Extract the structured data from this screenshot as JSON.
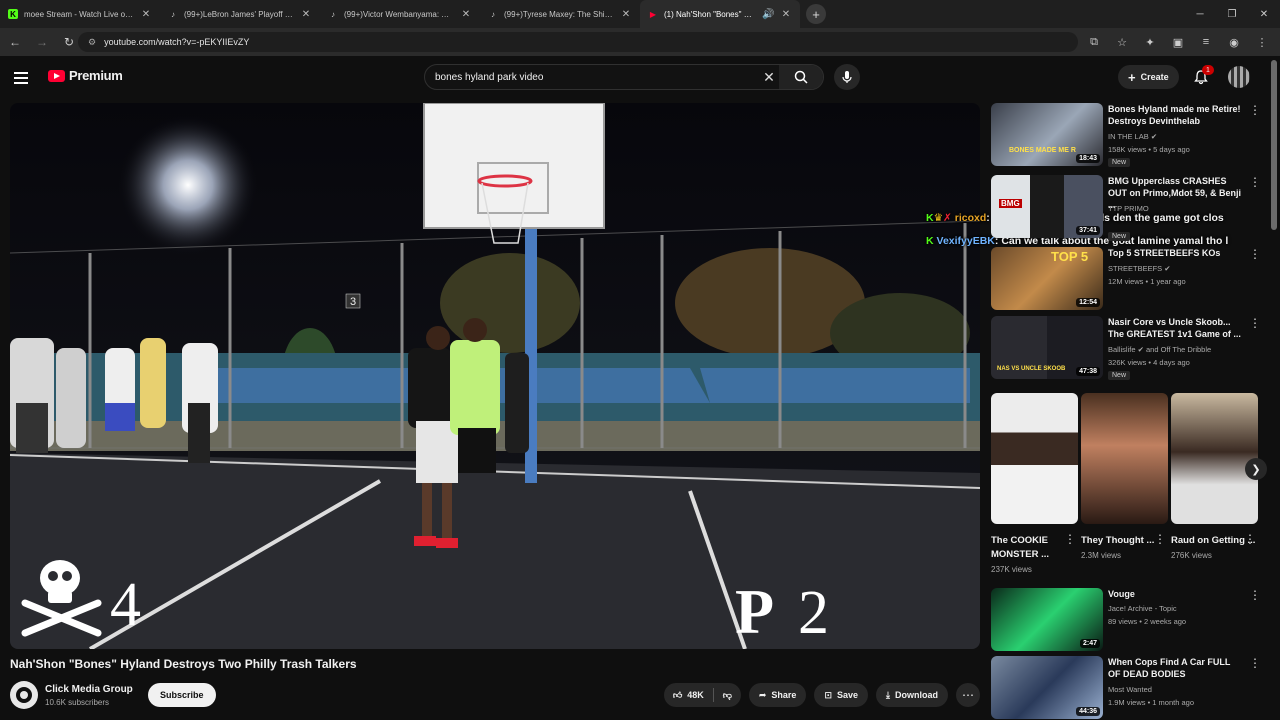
{
  "browser": {
    "tabs": [
      {
        "title": "moee Stream - Watch Live on K",
        "fav": "K",
        "favcolor": "#53fc18"
      },
      {
        "title": "(99+)LeBron James' Playoff High",
        "fav": "♪",
        "favcolor": "#ffffff"
      },
      {
        "title": "(99+)Victor Wembanyama: The M",
        "fav": "♪",
        "favcolor": "#ffffff"
      },
      {
        "title": "(99+)Tyrese Maxey: The Shiftiest",
        "fav": "♪",
        "favcolor": "#ffffff"
      },
      {
        "title": "(1) Nah'Shon \"Bones\" Hyland",
        "fav": "▶",
        "favcolor": "#ff0033"
      }
    ],
    "url": "youtube.com/watch?v=-pEKYIIEvZY"
  },
  "header": {
    "logo_text": "Premium",
    "search_query": "bones hyland park video",
    "create_label": "Create",
    "notification_count": "1"
  },
  "video": {
    "score_left": "4",
    "score_right": "2",
    "court_number": "3",
    "title": "Nah'Shon \"Bones\" Hyland Destroys Two Philly Trash Talkers",
    "channel": "Click Media Group",
    "subscribers": "10.6K subscribers",
    "subscribe_label": "Subscribe",
    "likes": "48K",
    "share_label": "Share",
    "save_label": "Save",
    "download_label": "Download"
  },
  "recommendations": [
    {
      "title": "Bones Hyland made me Retire! Destroys Devinthelab",
      "channel": "IN THE LAB",
      "verified": true,
      "meta": "158K views • 5 days ago",
      "new": "New",
      "duration": "18:43",
      "thumb_text": "BONES MADE ME R"
    },
    {
      "title": "BMG Upperclass CRASHES OUT on Primo,Mdot 59, & Benji ...",
      "channel": "TTP PRIMO",
      "verified": false,
      "meta": "",
      "new": "New",
      "duration": "37:41",
      "thumb_text": "BMG"
    },
    {
      "title": "Top 5 STREETBEEFS KOs",
      "channel": "STREETBEEFS",
      "verified": true,
      "meta": "12M views • 1 year ago",
      "new": "",
      "duration": "12:54",
      "thumb_text": "TOP 5"
    },
    {
      "title": "Nasir Core vs Uncle Skoob... The GREATEST 1v1 Game of ...",
      "channel": "Ballislife",
      "verified": true,
      "channel_extra": "and Off The Dribble",
      "meta": "326K views • 4 days ago",
      "new": "New",
      "duration": "47:38",
      "thumb_text": "NAS VS UNCLE SKOOB"
    }
  ],
  "shorts": [
    {
      "title": "The COOKIE MONSTER ...",
      "views": "237K views"
    },
    {
      "title": "They Thought ...",
      "views": "2.3M views"
    },
    {
      "title": "Raud on Getting ...",
      "views": "276K views"
    }
  ],
  "recommendations_lower": [
    {
      "title": "Vouge",
      "channel": "Jace! Archive - Topic",
      "meta": "89 views • 2 weeks ago",
      "duration": "2:47"
    },
    {
      "title": "When Cops Find A Car FULL OF DEAD BODIES",
      "channel": "Most Wanted",
      "meta": "1.9M views • 1 month ago",
      "duration": "44:36"
    }
  ],
  "chat_overlay": [
    {
      "user": "ricoxd",
      "message": "at first it was even calls den the game got clos"
    },
    {
      "user": "VexifyyEBK",
      "message": "Can we talk about the goat lamine yamal tho l"
    }
  ],
  "colors": {
    "youtube_red": "#ff0033",
    "kick_green": "#53fc18",
    "background": "#0f0f0f"
  }
}
